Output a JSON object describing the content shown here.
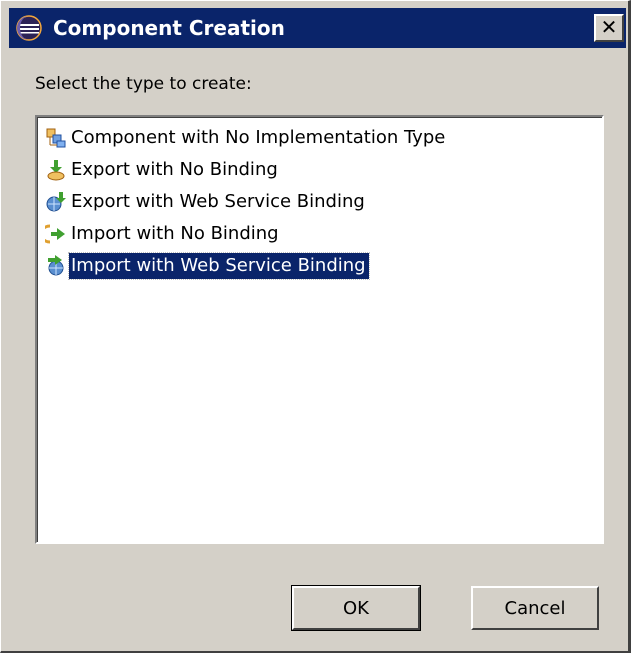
{
  "window": {
    "title": "Component Creation",
    "app_icon": "eclipse-icon",
    "close_label": "✕"
  },
  "prompt": "Select the type to create:",
  "list": {
    "items": [
      {
        "label": "Component with No Implementation Type",
        "icon": "component-icon",
        "selected": false
      },
      {
        "label": "Export with No Binding",
        "icon": "export-icon",
        "selected": false
      },
      {
        "label": "Export with Web Service Binding",
        "icon": "export-web-service-icon",
        "selected": false
      },
      {
        "label": "Import with No Binding",
        "icon": "import-icon",
        "selected": false
      },
      {
        "label": "Import with Web Service Binding",
        "icon": "import-web-service-icon",
        "selected": true
      }
    ]
  },
  "buttons": {
    "ok": "OK",
    "cancel": "Cancel"
  },
  "colors": {
    "titlebar": "#0a246a",
    "dialog_bg": "#d4d0c8",
    "selection": "#0a246a"
  }
}
